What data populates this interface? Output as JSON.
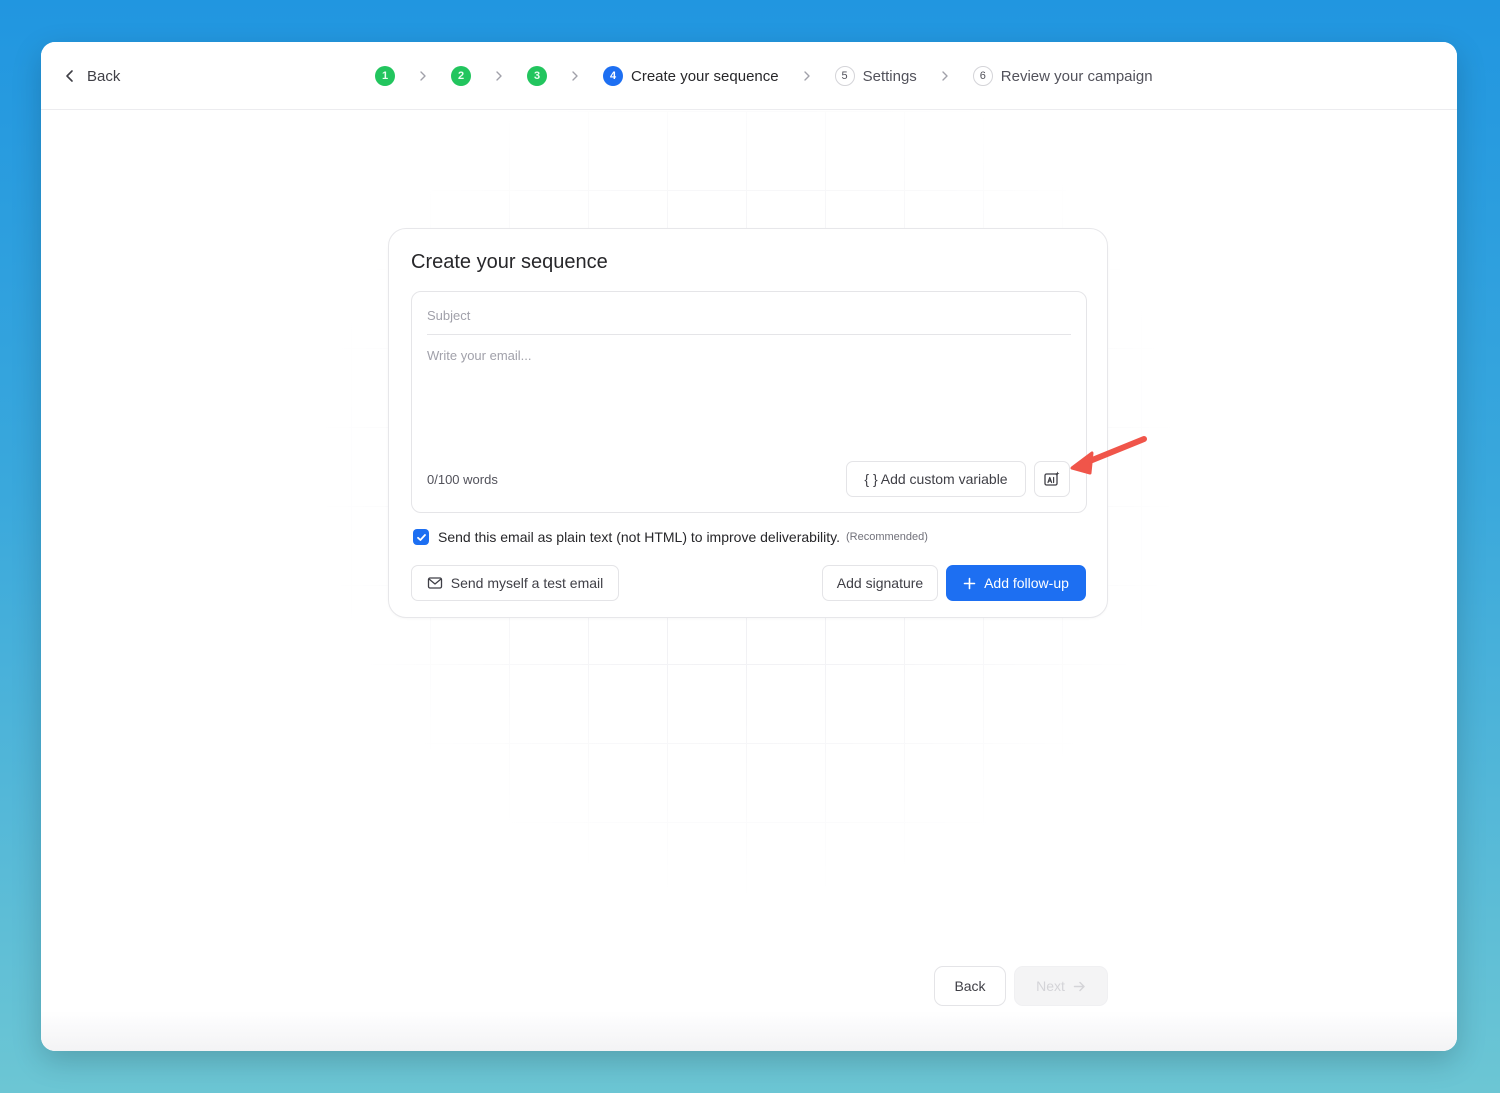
{
  "header": {
    "back_label": "Back",
    "steps": [
      {
        "number": "1",
        "label": "",
        "state": "done"
      },
      {
        "number": "2",
        "label": "",
        "state": "done"
      },
      {
        "number": "3",
        "label": "",
        "state": "done"
      },
      {
        "number": "4",
        "label": "Create your sequence",
        "state": "active"
      },
      {
        "number": "5",
        "label": "Settings",
        "state": "todo"
      },
      {
        "number": "6",
        "label": "Review your campaign",
        "state": "todo"
      }
    ]
  },
  "card": {
    "title": "Create your sequence",
    "subject_placeholder": "Subject",
    "body_placeholder": "Write your email...",
    "word_count": "0/100 words",
    "custom_variable_label": "{ } Add custom variable",
    "plain_text_label": "Send this email as plain text (not HTML) to improve deliverability.",
    "plain_text_checked": true,
    "recommended_label": "(Recommended)",
    "test_email_label": "Send myself a test email",
    "signature_label": "Add signature",
    "follow_up_label": "Add follow-up"
  },
  "footer": {
    "back_label": "Back",
    "next_label": "Next"
  },
  "colors": {
    "primary": "#1d6ff2",
    "done": "#22c55e",
    "annotation_arrow": "#f0554a"
  }
}
